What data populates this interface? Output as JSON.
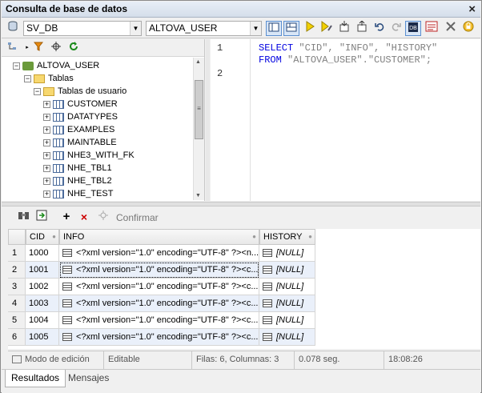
{
  "window": {
    "title": "Consulta de base de datos",
    "close_glyph": "×"
  },
  "toolbar": {
    "datasource": "SV_DB",
    "schema": "ALTOVA_USER"
  },
  "tree": {
    "root": "ALTOVA_USER",
    "tables_folder": "Tablas",
    "user_tables_folder": "Tablas de usuario",
    "tables": [
      "CUSTOMER",
      "DATATYPES",
      "EXAMPLES",
      "MAINTABLE",
      "NHE3_WITH_FK",
      "NHE_TBL1",
      "NHE_TBL2",
      "NHE_TEST"
    ]
  },
  "editor": {
    "line_numbers": [
      "1",
      "2"
    ],
    "line1": {
      "kw1": "SELECT",
      "cols": " \"CID\", \"INFO\", \"HISTORY\""
    },
    "line2": {
      "kw1": "FROM",
      "tbl": " \"ALTOVA_USER\".\"CUSTOMER\";"
    }
  },
  "results_toolbar": {
    "commit_label": "Confirmar",
    "add_glyph": "+",
    "delete_glyph": "×"
  },
  "grid": {
    "columns": [
      "CID",
      "INFO",
      "HISTORY"
    ],
    "rows": [
      {
        "n": "1",
        "cid": "1000",
        "info": "<?xml version=\"1.0\" encoding=\"UTF-8\" ?><n...",
        "history": "[NULL]"
      },
      {
        "n": "2",
        "cid": "1001",
        "info": "<?xml version=\"1.0\" encoding=\"UTF-8\" ?><c...",
        "history": "[NULL]"
      },
      {
        "n": "3",
        "cid": "1002",
        "info": "<?xml version=\"1.0\" encoding=\"UTF-8\" ?><c...",
        "history": "[NULL]"
      },
      {
        "n": "4",
        "cid": "1003",
        "info": "<?xml version=\"1.0\" encoding=\"UTF-8\" ?><c...",
        "history": "[NULL]"
      },
      {
        "n": "5",
        "cid": "1004",
        "info": "<?xml version=\"1.0\" encoding=\"UTF-8\" ?><c...",
        "history": "[NULL]"
      },
      {
        "n": "6",
        "cid": "1005",
        "info": "<?xml version=\"1.0\" encoding=\"UTF-8\" ?><c...",
        "history": "[NULL]"
      }
    ]
  },
  "status": {
    "mode": "Modo de edición",
    "editable": "Editable",
    "counts": "Filas: 6, Columnas: 3",
    "time": "0.078 seg.",
    "clock": "18:08:26"
  },
  "tabs": {
    "results": "Resultados",
    "messages": "Mensajes"
  },
  "colors": {
    "keyword": "#0000e0",
    "string": "#808080",
    "alt_row": "#eaf0fa"
  }
}
